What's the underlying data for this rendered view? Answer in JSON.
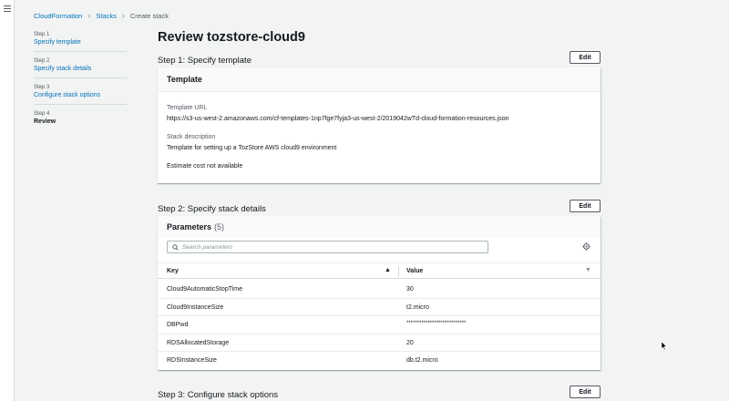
{
  "breadcrumb": {
    "items": [
      "CloudFormation",
      "Stacks",
      "Create stack"
    ]
  },
  "steps": [
    {
      "num": "Step 1",
      "label": "Specify template"
    },
    {
      "num": "Step 2",
      "label": "Specify stack details"
    },
    {
      "num": "Step 3",
      "label": "Configure stack options"
    },
    {
      "num": "Step 4",
      "label": "Review"
    }
  ],
  "page_title": "Review tozstore-cloud9",
  "step1": {
    "title": "Step 1: Specify template",
    "edit_label": "Edit",
    "panel_title": "Template",
    "template_url_label": "Template URL",
    "template_url": "https://s3-us-west-2.amazonaws.com/cf-templates-1np7fge7fyja3-us-west-2/2019042wTd-cloud-formation-resources.json",
    "desc_label": "Stack description",
    "desc": "Template for setting up a TozStore AWS cloud9 environment",
    "cost": "Estimate cost not available"
  },
  "step2": {
    "title": "Step 2: Specify stack details",
    "edit_label": "Edit",
    "panel_title": "Parameters",
    "count": "(5)",
    "search_placeholder": "Search parameters",
    "col_key": "Key",
    "col_value": "Value",
    "rows": [
      {
        "key": "Cloud9AutomaticStopTime",
        "value": "30"
      },
      {
        "key": "Cloud9InstanceSize",
        "value": "t2.micro"
      },
      {
        "key": "DBPwd",
        "value": "****************************"
      },
      {
        "key": "RDSAllocatedStorage",
        "value": "20"
      },
      {
        "key": "RDSInstanceSize",
        "value": "db.t2.micro"
      }
    ]
  },
  "step3": {
    "title": "Step 3: Configure stack options",
    "edit_label": "Edit"
  }
}
